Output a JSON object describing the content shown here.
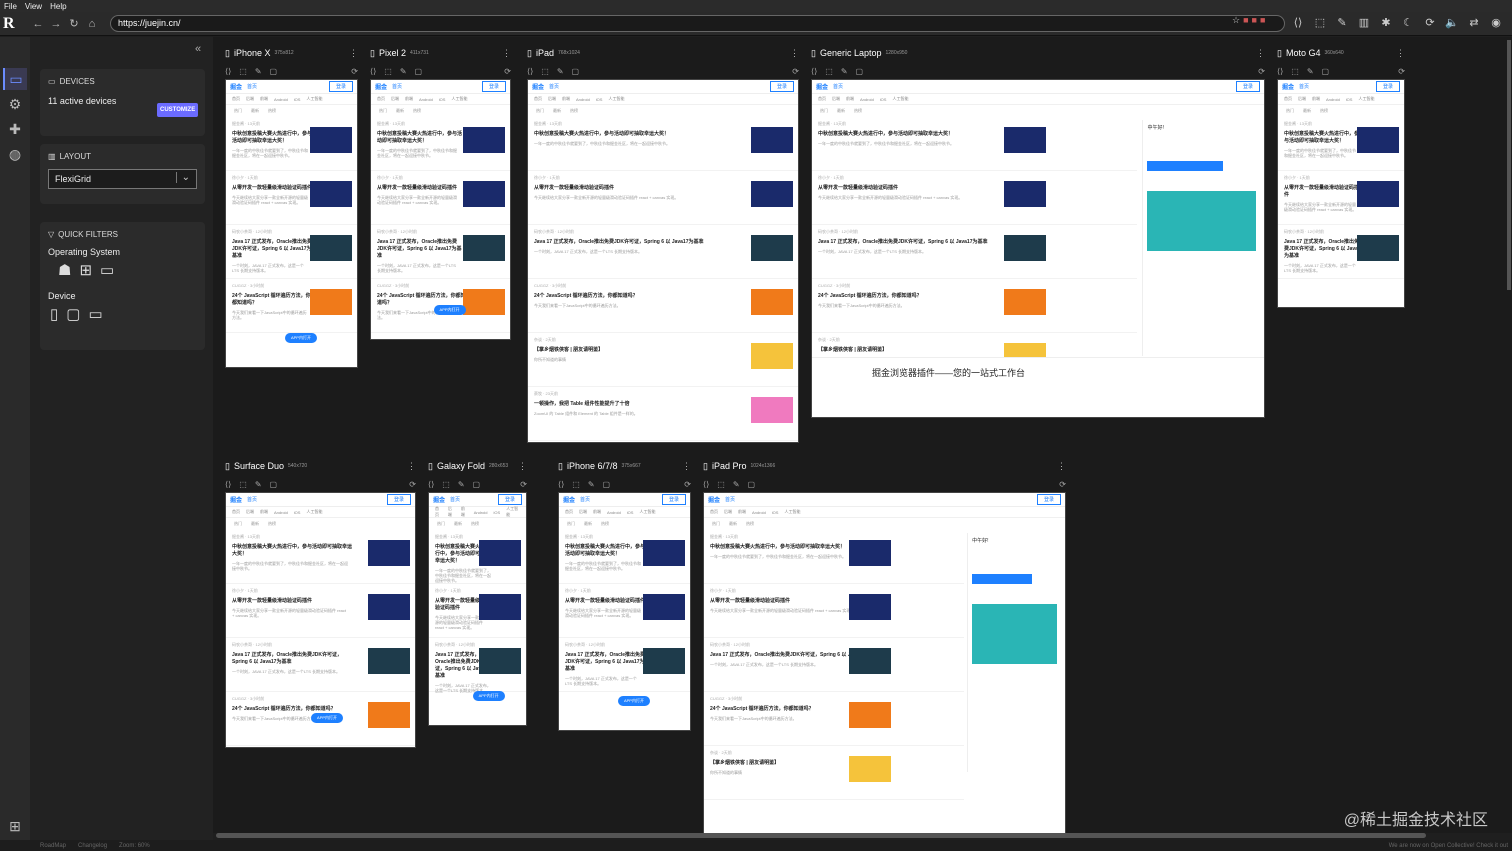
{
  "menu": [
    "File",
    "View",
    "Help"
  ],
  "app": {
    "logo": "R"
  },
  "url": "https://juejin.cn/",
  "rail": [
    {
      "icon": "devices-icon"
    },
    {
      "icon": "gear-icon"
    },
    {
      "icon": "puzzle-icon"
    },
    {
      "icon": "globe-icon"
    }
  ],
  "devices_panel": {
    "title": "DEVICES",
    "count_text": "11 active devices",
    "customize": "CUSTOMIZE"
  },
  "layout_panel": {
    "title": "LAYOUT",
    "value": "FlexiGrid"
  },
  "filters_panel": {
    "title": "QUICK FILTERS",
    "os_label": "Operating System",
    "device_label": "Device"
  },
  "colors": {
    "accent": "#6b6bff",
    "juejin_blue": "#1e80ff"
  },
  "frames": [
    {
      "name": "iPhone X",
      "dim": "375x812"
    },
    {
      "name": "Pixel 2",
      "dim": "411x731"
    },
    {
      "name": "iPad",
      "dim": "768x1024"
    },
    {
      "name": "Generic Laptop",
      "dim": "1280x950"
    },
    {
      "name": "Moto G4",
      "dim": "360x640"
    },
    {
      "name": "Surface Duo",
      "dim": "540x720"
    },
    {
      "name": "Galaxy Fold",
      "dim": "280x653"
    },
    {
      "name": "iPhone 6/7/8",
      "dim": "375x667"
    },
    {
      "name": "iPad Pro",
      "dim": "1024x1366"
    }
  ],
  "juejin": {
    "logo": "掘金",
    "home": "首页",
    "login": "登录",
    "nav": [
      "首页",
      "后端",
      "前端",
      "Android",
      "iOS",
      "人工智能"
    ],
    "sub": [
      "热门",
      "最新",
      "热榜"
    ],
    "articles": [
      {
        "meta": "掘金酱 · 13天前",
        "title": "中秋创意投稿大赛火热进行中，参与活动即可抽取幸运大奖！",
        "desc": "一年一度的中秋佳节就要到了，中秋佳节和掘金社区，将在一起迎接中秋节。"
      },
      {
        "meta": "徐小夕 · 1天前",
        "title": "从零开发一款轻量级滑动验证码插件",
        "desc": "今天继续给大家分享一款全新开源的轻量级滑动验证码插件 react + canvas 实现。",
        "badge": "开源推荐"
      },
      {
        "meta": "码农小茶哥 · 12小时前",
        "title": "Java 17 正式发布，Oracle推出免费JDK许可证，Spring 6 以 Java17为基准",
        "desc": "一个时刻，JAVA 17 正式发布，这是一个LTS 长期支持版本。"
      },
      {
        "meta": "CUGGZ · 3小时前",
        "title": "24个 JavaScript 循环遍历方法，你都知道吗？",
        "desc": "今天我们来看一下JavaScript中的循环遍历方法。"
      },
      {
        "meta": "杂谈 · 2天前",
        "title": "【掌乡烟铁侠客 | 朋友请明鉴】",
        "desc": "你所不知道的事情"
      },
      {
        "meta": "蔡牧 · 23天前",
        "title": "一顿操作，我把 Table 组件性能提升了十倍",
        "desc": "ZoomUI 的 Table 组件和 Element 的 Table 组件是一样的。"
      }
    ],
    "pill": "APP内打开",
    "promo": "掘金浏览器插件——您的一站式工作台",
    "aside_greet": "中午好!"
  },
  "status": {
    "items": [
      "RoadMap",
      "Changelog",
      "Zoom: 60%"
    ],
    "right": "We are now on Open Collective! Check it out"
  },
  "watermark": "@稀土掘金技术社区"
}
